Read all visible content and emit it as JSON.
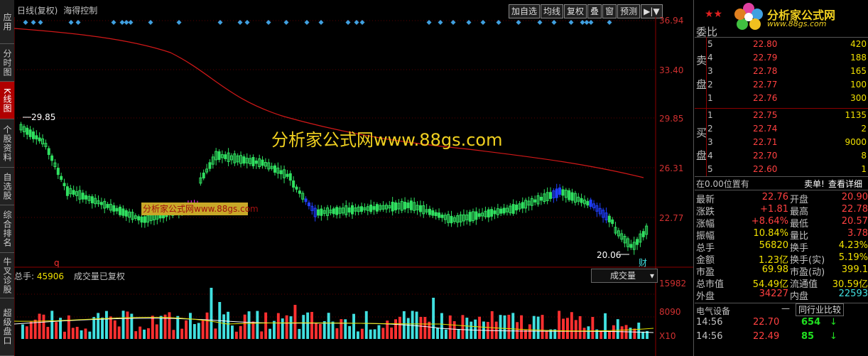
{
  "left_tabs": [
    {
      "label": "应用",
      "active": false
    },
    {
      "label": "分时图",
      "active": false
    },
    {
      "label": "K线图",
      "active": true
    },
    {
      "label": "个股资料",
      "active": false
    },
    {
      "label": "自选股",
      "active": false
    },
    {
      "label": "综合排名",
      "active": false
    },
    {
      "label": "牛叉诊股",
      "active": false
    },
    {
      "label": "超级盘口",
      "active": false
    }
  ],
  "chart_header": {
    "period": "日线(复权)",
    "indicator": "海得控制"
  },
  "toolbar": [
    "加自选",
    "均线",
    "复权",
    "叠",
    "窗",
    "预测",
    "▶|▼"
  ],
  "watermark": "分析家公式网www.88gs.com",
  "watermark_box": "分析家公式网www.88gs.com",
  "price_axis": [
    "36.94",
    "33.40",
    "29.85",
    "26.31",
    "22.77"
  ],
  "high_label": "29.85",
  "low_label": "20.06",
  "cai_label": "财",
  "q_label": "q",
  "volume_header": {
    "total_label": "总手:",
    "total_value": "45906",
    "note": "成交量已复权",
    "dropdown": "成交量"
  },
  "volume_axis": [
    "15982",
    "8090",
    "X10"
  ],
  "logo": {
    "text": "分析家公式网",
    "url": "www.88gs.com",
    "stars": "★★"
  },
  "order_book": {
    "header": "委比",
    "sell_label": [
      "卖",
      "盘"
    ],
    "buy_label": [
      "买",
      "盘"
    ],
    "sell": [
      {
        "level": "5",
        "price": "22.80",
        "volume": "420"
      },
      {
        "level": "4",
        "price": "22.79",
        "volume": "188"
      },
      {
        "level": "3",
        "price": "22.78",
        "volume": "165"
      },
      {
        "level": "2",
        "price": "22.77",
        "volume": "100"
      },
      {
        "level": "1",
        "price": "22.76",
        "volume": "300"
      }
    ],
    "buy": [
      {
        "level": "1",
        "price": "22.75",
        "volume": "1135"
      },
      {
        "level": "2",
        "price": "22.74",
        "volume": "2"
      },
      {
        "level": "3",
        "price": "22.71",
        "volume": "9000"
      },
      {
        "level": "4",
        "price": "22.70",
        "volume": "8"
      },
      {
        "level": "5",
        "price": "22.60",
        "volume": "1"
      }
    ]
  },
  "position_line": {
    "left": "在0.00位置有",
    "mid": "卖单!",
    "right": "查看详细"
  },
  "stats": [
    {
      "k1": "最新",
      "v1": "22.76",
      "c1": "red",
      "k2": "开盘",
      "v2": "20.90",
      "c2": "red"
    },
    {
      "k1": "涨跌",
      "v1": "+1.81",
      "c1": "red",
      "k2": "最高",
      "v2": "22.78",
      "c2": "red"
    },
    {
      "k1": "涨幅",
      "v1": "+8.64%",
      "c1": "red",
      "k2": "最低",
      "v2": "20.57",
      "c2": "red"
    },
    {
      "k1": "振幅",
      "v1": "10.84%",
      "c1": "yel",
      "k2": "量比",
      "v2": "3.78",
      "c2": "red"
    },
    {
      "k1": "总手",
      "v1": "56820",
      "c1": "yel",
      "k2": "换手",
      "v2": "4.23%",
      "c2": "yel"
    },
    {
      "k1": "金额",
      "v1": "1.23亿",
      "c1": "yel",
      "k2": "换手(实)",
      "v2": "5.19%",
      "c2": "yel"
    },
    {
      "k1": "市盈",
      "v1": "69.98",
      "c1": "yel",
      "k2": "市盈(动)",
      "v2": "399.1",
      "c2": "yel"
    },
    {
      "k1": "总市值",
      "v1": "54.49亿",
      "c1": "yel",
      "k2": "流通值",
      "v2": "30.59亿",
      "c2": "yel"
    },
    {
      "k1": "外盘",
      "v1": "34227",
      "c1": "red",
      "k2": "内盘",
      "v2": "22593",
      "c2": "cyan"
    }
  ],
  "industry": {
    "name": "电气设备",
    "compare": "同行业比较"
  },
  "ticks": [
    {
      "time": "14:56",
      "price": "22.70",
      "volume": "654"
    },
    {
      "time": "14:56",
      "price": "22.49",
      "volume": "85"
    }
  ],
  "colors": {
    "up": "#ff3030",
    "down": "#30e060",
    "ma": "#e02020",
    "volume_up": "#ff3030",
    "volume_down": "#40e0e0",
    "accent": "#f0d020"
  }
}
